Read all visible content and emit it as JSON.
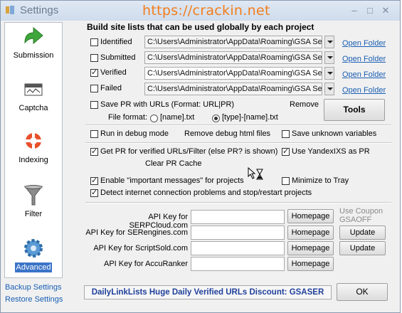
{
  "window": {
    "title": "Settings",
    "watermark": "https://crackin.net"
  },
  "sidebar": {
    "items": [
      {
        "label": "Submission"
      },
      {
        "label": "Captcha"
      },
      {
        "label": "Indexing"
      },
      {
        "label": "Filter"
      },
      {
        "label": "Advanced"
      }
    ],
    "backup_label": "Backup Settings",
    "restore_label": "Restore Settings"
  },
  "site_lists": {
    "heading": "Build site lists that can be used globally by each project",
    "open_folder_label": "Open Folder",
    "rows": [
      {
        "label": "Identified",
        "checked": false,
        "path": "C:\\Users\\Administrator\\AppData\\Roaming\\GSA Se"
      },
      {
        "label": "Submitted",
        "checked": false,
        "path": "C:\\Users\\Administrator\\AppData\\Roaming\\GSA Se"
      },
      {
        "label": "Verified",
        "checked": true,
        "path": "C:\\Users\\Administrator\\AppData\\Roaming\\GSA Se"
      },
      {
        "label": "Failed",
        "checked": false,
        "path": "C:\\Users\\Administrator\\AppData\\Roaming\\GSA Se"
      }
    ],
    "save_pr_label": "Save PR with URLs (Format: URL|PR)",
    "remove_label": "Remove",
    "tools_label": "Tools",
    "file_format_label": "File format:",
    "format_option_1": "[name].txt",
    "format_option_2": "[type]-[name].txt",
    "selected_format": "[type]-[name].txt"
  },
  "debug": {
    "run_debug_label": "Run in debug mode",
    "remove_debug_label": "Remove debug html files",
    "save_unknown_label": "Save unknown variables"
  },
  "options": {
    "get_pr_label": "Get PR for verified URLs/Filter  (else PR? is shown)",
    "use_yandex_label": "Use YandexIXS as PR",
    "clear_pr_label": "Clear PR Cache",
    "important_messages_label": "Enable \"important messages\" for projects",
    "minimize_tray_label": "Minimize to Tray",
    "detect_connection_label": "Detect internet connection problems and stop/restart projects"
  },
  "api_keys": {
    "rows": [
      {
        "label": "API Key for SERPCloud.com",
        "value": ""
      },
      {
        "label": "API Key for SERengines.com",
        "value": ""
      },
      {
        "label": "API Key for ScriptSold.com",
        "value": ""
      },
      {
        "label": "API Key for AccuRanker",
        "value": ""
      }
    ],
    "homepage_label": "Homepage",
    "update_label": "Update",
    "coupon_line1": "Use Coupon",
    "coupon_line2": "GSAOFF"
  },
  "footer": {
    "banner": "DailyLinkLists Huge Daily Verified URLs Discount: GSASER",
    "ok_label": "OK"
  },
  "colors": {
    "accent": "#3a74c7",
    "link": "#1a5fb4",
    "watermark": "#f27d1c",
    "banner_text": "#1f3f9a"
  }
}
